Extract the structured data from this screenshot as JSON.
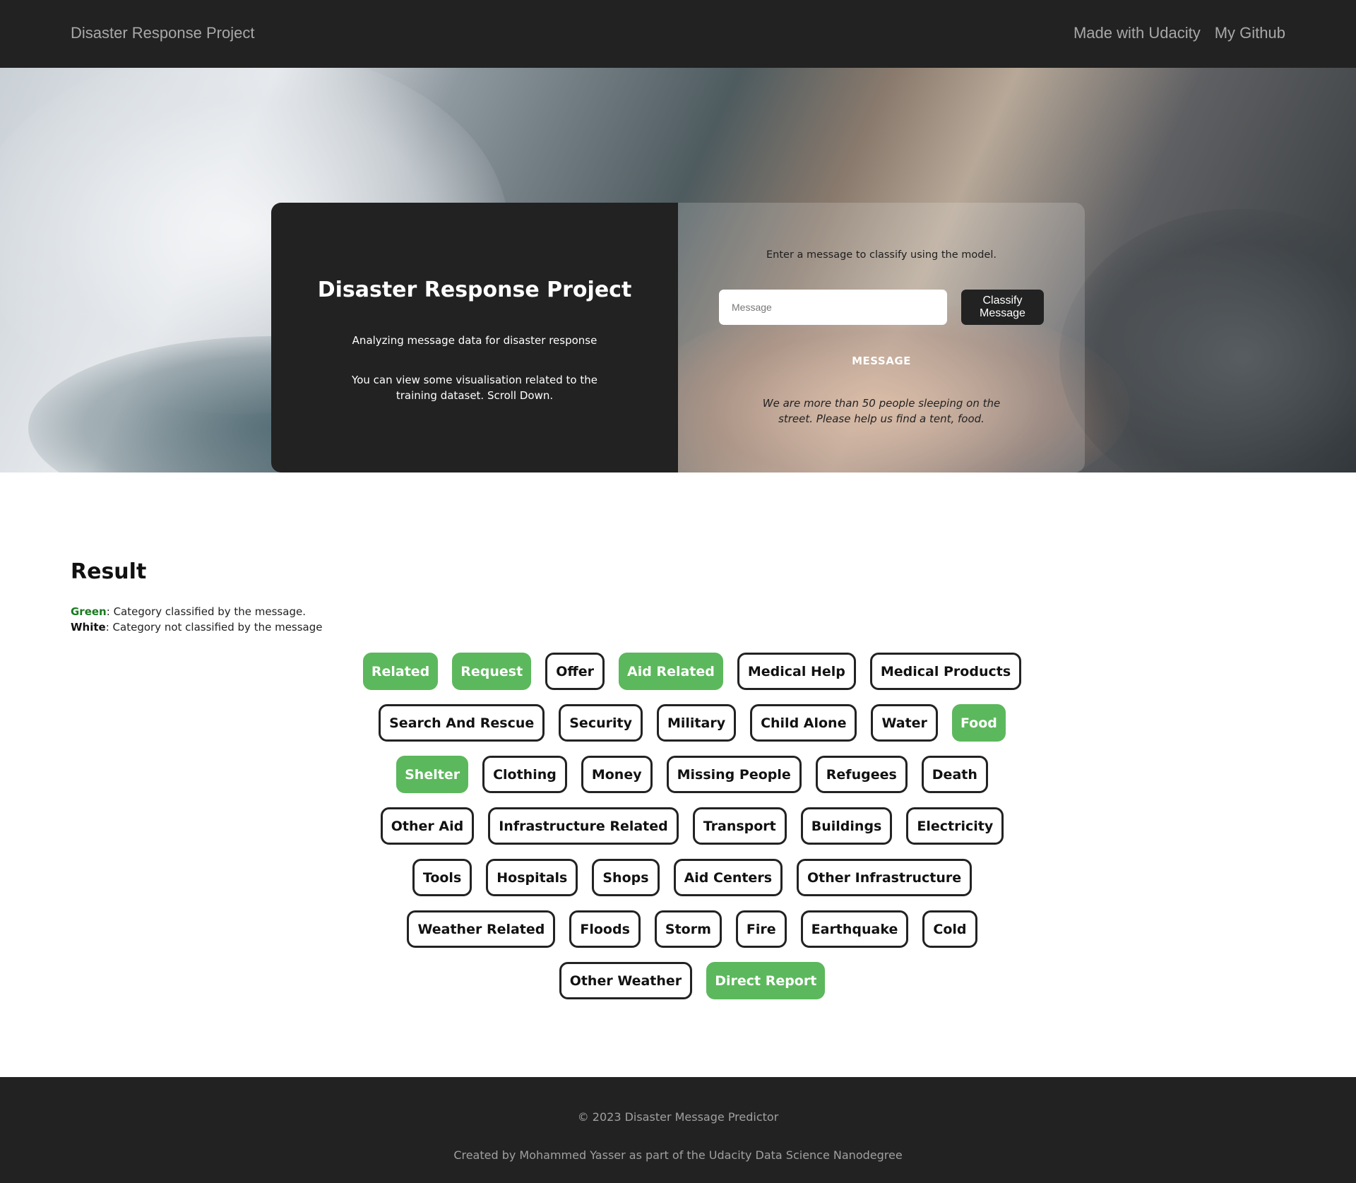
{
  "navbar": {
    "brand": "Disaster Response Project",
    "links": [
      "Made with Udacity",
      "My Github"
    ]
  },
  "hero": {
    "title": "Disaster Response Project",
    "subtitle": "Analyzing message data for disaster response",
    "note": "You can view some visualisation related to the training dataset. Scroll Down.",
    "prompt": "Enter a message to classify using the model.",
    "input_placeholder": "Message",
    "input_value": "",
    "classify_label": "Classify Message",
    "message_heading": "MESSAGE",
    "message_text": "We are more than 50 people sleeping on the street. Please help us find a tent, food."
  },
  "result": {
    "title": "Result",
    "legend_green_word": "Green",
    "legend_green_text": ": Category classified by the message.",
    "legend_white_word": "White",
    "legend_white_text": ": Category not classified by the message"
  },
  "colors": {
    "classified": "#5cb85c",
    "not_classified": "#ffffff",
    "dark": "#222222"
  },
  "category_rows": [
    [
      {
        "label": "Related",
        "classified": true
      },
      {
        "label": "Request",
        "classified": true
      },
      {
        "label": "Offer",
        "classified": false
      },
      {
        "label": "Aid Related",
        "classified": true
      },
      {
        "label": "Medical Help",
        "classified": false
      },
      {
        "label": "Medical Products",
        "classified": false
      }
    ],
    [
      {
        "label": "Search And Rescue",
        "classified": false
      },
      {
        "label": "Security",
        "classified": false
      },
      {
        "label": "Military",
        "classified": false
      },
      {
        "label": "Child Alone",
        "classified": false
      },
      {
        "label": "Water",
        "classified": false
      },
      {
        "label": "Food",
        "classified": true
      }
    ],
    [
      {
        "label": "Shelter",
        "classified": true
      },
      {
        "label": "Clothing",
        "classified": false
      },
      {
        "label": "Money",
        "classified": false
      },
      {
        "label": "Missing People",
        "classified": false
      },
      {
        "label": "Refugees",
        "classified": false
      },
      {
        "label": "Death",
        "classified": false
      }
    ],
    [
      {
        "label": "Other Aid",
        "classified": false
      },
      {
        "label": "Infrastructure Related",
        "classified": false
      },
      {
        "label": "Transport",
        "classified": false
      },
      {
        "label": "Buildings",
        "classified": false
      },
      {
        "label": "Electricity",
        "classified": false
      }
    ],
    [
      {
        "label": "Tools",
        "classified": false
      },
      {
        "label": "Hospitals",
        "classified": false
      },
      {
        "label": "Shops",
        "classified": false
      },
      {
        "label": "Aid Centers",
        "classified": false
      },
      {
        "label": "Other Infrastructure",
        "classified": false
      }
    ],
    [
      {
        "label": "Weather Related",
        "classified": false
      },
      {
        "label": "Floods",
        "classified": false
      },
      {
        "label": "Storm",
        "classified": false
      },
      {
        "label": "Fire",
        "classified": false
      },
      {
        "label": "Earthquake",
        "classified": false
      },
      {
        "label": "Cold",
        "classified": false
      }
    ],
    [
      {
        "label": "Other Weather",
        "classified": false
      },
      {
        "label": "Direct Report",
        "classified": true
      }
    ]
  ],
  "footer": {
    "copyright": "© 2023 Disaster Message Predictor",
    "credit": "Created by Mohammed Yasser as part of the Udacity Data Science Nanodegree"
  }
}
